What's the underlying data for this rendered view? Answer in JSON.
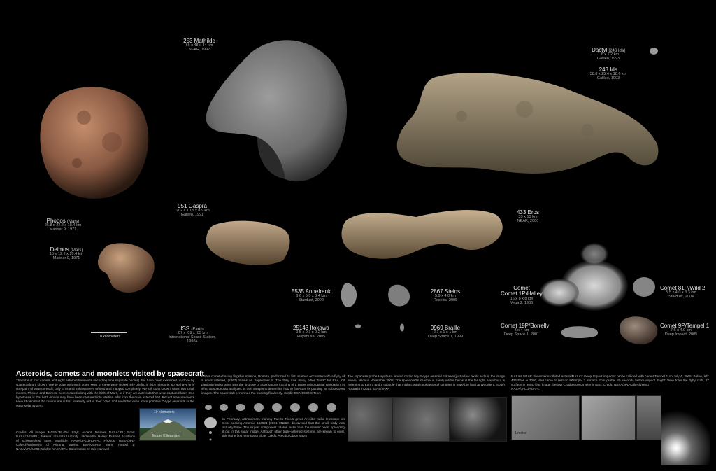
{
  "objects": {
    "mathilde": {
      "name": "253 Mathilde",
      "dims": "66 x 48 x 44 km",
      "mission": "NEAR, 1997"
    },
    "dactyl": {
      "name": "Dactyl",
      "host": "[243 Ida]",
      "dims": "1.6 x 1.2 km",
      "mission": "Galileo, 1993"
    },
    "ida": {
      "name": "243 Ida",
      "dims": "58.8 x 25.4 x 18.6 km",
      "mission": "Galileo, 1993"
    },
    "phobos": {
      "name": "Phobos",
      "host": "(Mars)",
      "dims": "26.8 x 22.4 x 18.4 km",
      "mission": "Mariner 9, 1971"
    },
    "deimos": {
      "name": "Deimos",
      "host": "(Mars)",
      "dims": "15 x 12.2 x 10.4 km",
      "mission": "Mariner 9, 1971"
    },
    "gaspra": {
      "name": "951 Gaspra",
      "dims": "18.2 x 10.5 x 8.9 km",
      "mission": "Galileo, 1991"
    },
    "eros": {
      "name": "433 Eros",
      "dims": "33 x 13 km",
      "mission": "NEAR, 2000"
    },
    "annefrank": {
      "name": "5535 Annefrank",
      "dims": "6.6 x 5.0 x 3.4 km",
      "mission": "Stardust, 2002"
    },
    "steins": {
      "name": "2867 Steins",
      "dims": "5.9 x 4.0 km",
      "mission": "Rosetta, 2008"
    },
    "halley": {
      "name": "Comet 1P/Halley",
      "dims": "16 x 8 x 8 km",
      "mission": "Vega 2, 1986"
    },
    "wild2": {
      "name": "Comet 81P/Wild 2",
      "dims": "5.5 x 4.0 x 3.3 km",
      "mission": "Stardust, 2004"
    },
    "iss": {
      "name": "ISS",
      "host": "(Earth)",
      "dims": ".07 x .09 x .03 km",
      "mission": "International Space Station, 1998+"
    },
    "itokawa": {
      "name": "25143 Itokawa",
      "dims": "0.5 x 0.3 x 0.2 km",
      "mission": "Hayabusa, 2005"
    },
    "braille": {
      "name": "9969 Braille",
      "dims": "2.1 x 1 x 1 km",
      "mission": "Deep Space 1, 1999"
    },
    "borrelly": {
      "name": "Comet 19P/Borrelly",
      "dims": "8 x 4 km",
      "mission": "Deep Space 1, 2001"
    },
    "tempel1": {
      "name": "Comet 9P/Tempel 1",
      "dims": "7.6 x 4.9 km",
      "mission": "Deep Impact, 2005"
    }
  },
  "scale_label": "10 kilometers",
  "bottom": {
    "title": "Asteroids, comets and moonlets visited by spacecraft",
    "intro": "The total of four comets and eight asteroid transients (including nine separate bodies) that have been examined up close by spacecraft are shown here to scale with each other. Most of these were visited only briefly, in flyby missions, so we have only one point of view on each; only Eros and Itokawa were orbited and mapped completely. We still don't know if Mars' two small moons, Phobos and Deimos, were created along with the birth of Mars, or if they are asteroids that were captured later. One hypothesis is that both moons may have been captured into Martian orbit from the main asteroid belt. Recent measurements have shown that the moons are in fact relatively red in their color, and resemble even more primitive D-type asteroids in the outer solar system.",
    "credits": "Credits: All images NASA/JPL/Ted Stryk, except: Deimos: NASA/JPL; Eros: NASA/JHUAPL; Itokawa: ISAS/JAXA/Emily Lakdawalla; Halley: Russian Academy of Sciences/Ted Stryk; Mathilde: NASA/JPL/JHUAPL; Phobos: NASA/JPL-Caltech/University of Arizona; Steins: ESA/OSIRIS team; Tempel 1: NASA/JPL/UMD; Wild 2: NASA/JPL. Colorization by Eric Hartwell",
    "kilimanjaro_scale": "10 kilometers",
    "kilimanjaro_label": "Mount Kilimanjaro",
    "rosetta_text": "ESA's comet-chasing flagship mission, Rosetta, performed its first science encounter with a flyby of a small asteroid, (2867) Steins on September 5. The flyby saw many other \"firsts\" for ESA. Of particular importance was the first use of autonomous tracking of a target using optical navigation, in which a spacecraft analyzes its own images to determine how to fine-tune its pointing for subsequent images. The spacecraft performed the tracking flawlessly. Credit: ESA/OSIRIS Team",
    "arecibo_text": "In February, astronomers training Puerto Rico's great Arecibo radio telescope on close-passing Asteroid 153591 (2001 SN263) discovered that the small body was actually three. The largest component rotates faster than the smaller ones, spreading it out in this radar image. Although other triple-asteroid systems are known to exist, this is the first near-Earth triple. Credit: Arecibo Observatory",
    "hayabusa_text": "The Japanese probe Hayabusa landed on the tiny S-type asteroid Itokawa (just a few pixels wide in the image above) twice in November 2005. The spacecraft's shadow is barely visible below at the far right. Hayabusa is returning to Earth, and a capsule that might contain Itokawa soil samples is hoped to land at Woomera, South Australia in 2010. ISAS/JAXA",
    "near_text": "NASA's NEAR Shoemaker orbited asteroid 433 Eros in 2000, and came to rest on its surface in 2001 (last image, below) Credit: NASA/JPL/JHUAPL.",
    "eros_scale": "1 meter",
    "deepimpact_text": "NASA's Deep Impact impactor probe collided with comet Tempel 1 on July 4, 2005. Below, left: Tempel 1 surface from probe, 20 seconds before impact. Right: View from the flyby craft, 67 seconds after impact. Credit: NASA/JPL-Caltech/UMD"
  }
}
